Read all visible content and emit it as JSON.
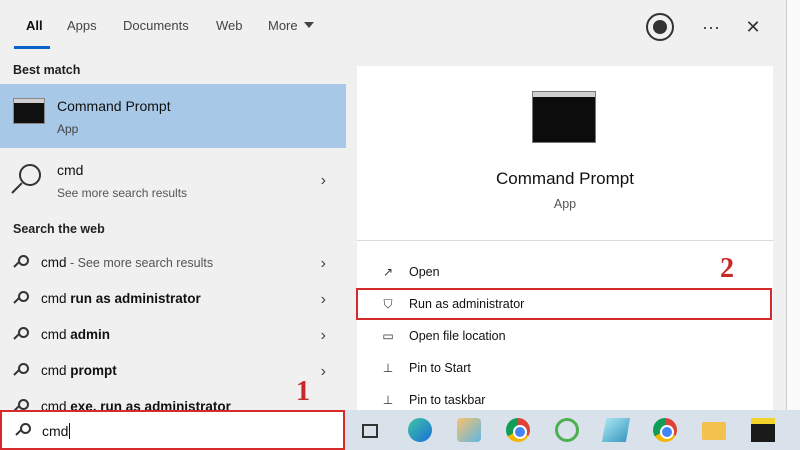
{
  "tabs": [
    {
      "label": "All",
      "active": true
    },
    {
      "label": "Apps",
      "active": false
    },
    {
      "label": "Documents",
      "active": false
    },
    {
      "label": "Web",
      "active": false
    },
    {
      "label": "More",
      "active": false
    }
  ],
  "top_icons": {
    "feedback": "feedback-icon",
    "more": "···",
    "close": "✕"
  },
  "left": {
    "best_match_label": "Best match",
    "best_match": {
      "title": "Command Prompt",
      "subtitle": "App"
    },
    "cmd_result": {
      "title": "cmd",
      "subtitle": "See more search results"
    },
    "search_web_label": "Search the web",
    "web_results": [
      {
        "prefix": "cmd",
        "hint": " - See more search results",
        "bold": ""
      },
      {
        "prefix": "cmd ",
        "hint": "",
        "bold": "run as administrator"
      },
      {
        "prefix": "cmd ",
        "hint": "",
        "bold": "admin"
      },
      {
        "prefix": "cmd ",
        "hint": "",
        "bold": "prompt"
      },
      {
        "prefix": "cmd ",
        "hint": "",
        "bold": "exe, run as administrator"
      }
    ]
  },
  "right": {
    "title": "Command Prompt",
    "subtitle": "App",
    "actions": [
      {
        "label": "Open",
        "icon": "open-icon"
      },
      {
        "label": "Run as administrator",
        "icon": "shield-icon"
      },
      {
        "label": "Open file location",
        "icon": "file-location-icon"
      },
      {
        "label": "Pin to Start",
        "icon": "pin-icon"
      },
      {
        "label": "Pin to taskbar",
        "icon": "pin-icon"
      }
    ]
  },
  "annotations": {
    "step1": "1",
    "step2": "2"
  },
  "search": {
    "value": "cmd"
  },
  "colors": {
    "highlight": "#a8c8e8",
    "annotation_red": "#d62b2b",
    "accent": "#0a64c8"
  }
}
